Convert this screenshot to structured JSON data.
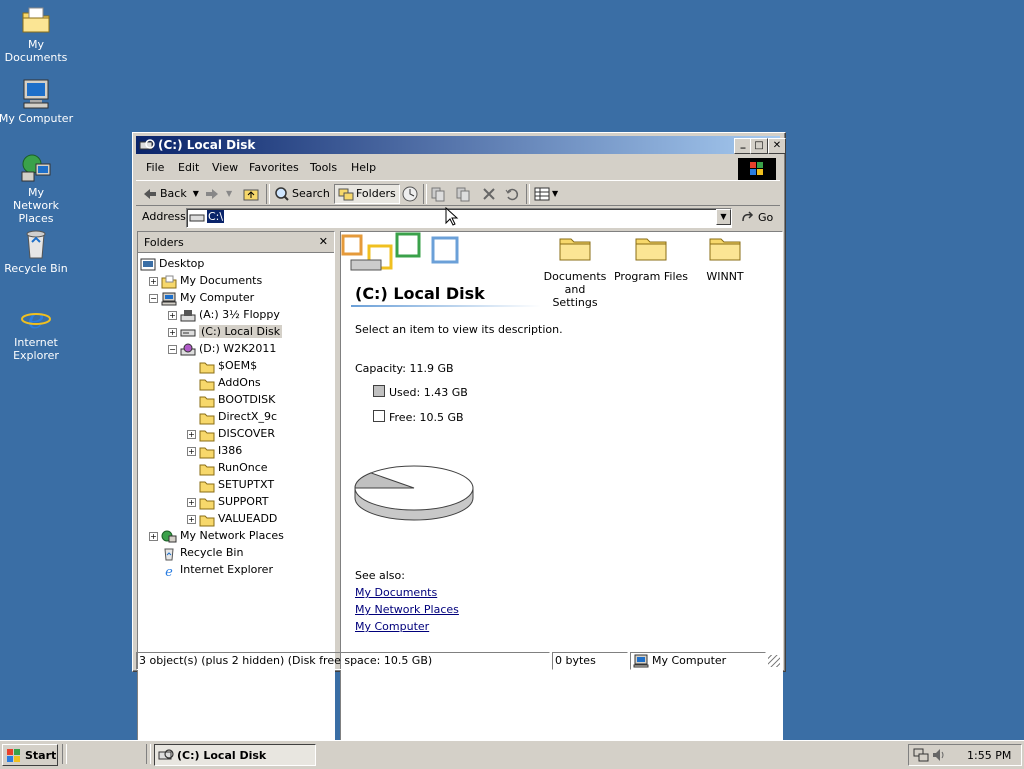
{
  "desktop": {
    "icons": [
      {
        "label": "My Documents"
      },
      {
        "label": "My Computer"
      },
      {
        "label": "My Network Places"
      },
      {
        "label": "Recycle Bin"
      },
      {
        "label": "Internet Explorer"
      }
    ]
  },
  "window": {
    "title": "(C:) Local Disk",
    "controls": {
      "minimize": "_",
      "maximize": "□",
      "close": "✕"
    },
    "menu": [
      "File",
      "Edit",
      "View",
      "Favorites",
      "Tools",
      "Help"
    ],
    "toolbar": {
      "back": "Back",
      "search": "Search",
      "folders": "Folders"
    },
    "address": {
      "label": "Address",
      "value": "C:\\",
      "go": "Go"
    },
    "folders_pane": {
      "title": "Folders",
      "close": "✕",
      "tree": [
        {
          "label": "Desktop"
        },
        {
          "label": "My Documents"
        },
        {
          "label": "My Computer"
        },
        {
          "label": "(A:) 3½ Floppy"
        },
        {
          "label": "(C:) Local Disk"
        },
        {
          "label": "(D:) W2K2011"
        },
        {
          "label": "$OEM$"
        },
        {
          "label": "AddOns"
        },
        {
          "label": "BOOTDISK"
        },
        {
          "label": "DirectX_9c"
        },
        {
          "label": "DISCOVER"
        },
        {
          "label": "I386"
        },
        {
          "label": "RunOnce"
        },
        {
          "label": "SETUPTXT"
        },
        {
          "label": "SUPPORT"
        },
        {
          "label": "VALUEADD"
        },
        {
          "label": "My Network Places"
        },
        {
          "label": "Recycle Bin"
        },
        {
          "label": "Internet Explorer"
        }
      ]
    },
    "info": {
      "heading": "(C:) Local Disk",
      "description": "Select an item to view its description.",
      "capacity": "Capacity: 11.9 GB",
      "used": "Used: 1.43 GB",
      "free": "Free: 10.5 GB",
      "used_fraction": 0.12,
      "see_also": "See also:",
      "links": [
        "My Documents",
        "My Network Places",
        "My Computer"
      ]
    },
    "files": [
      {
        "name": "Documents and Settings"
      },
      {
        "name": "Program Files"
      },
      {
        "name": "WINNT"
      }
    ],
    "status": {
      "objects": "3 object(s) (plus 2 hidden) (Disk free space: 10.5 GB)",
      "size": "0 bytes",
      "zone": "My Computer"
    }
  },
  "taskbar": {
    "start": "Start",
    "task": "(C:) Local Disk",
    "clock": "1:55 PM"
  }
}
